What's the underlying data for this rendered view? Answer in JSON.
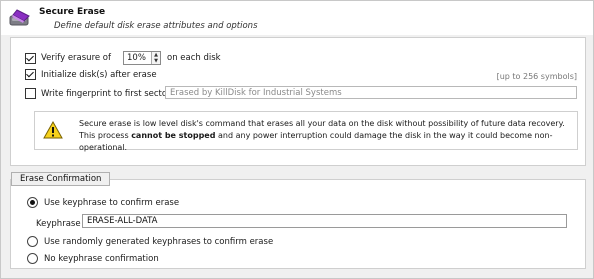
{
  "header": {
    "title": "Secure Erase",
    "subtitle": "Define default disk erase attributes and options",
    "icon": "disk-eraser-icon"
  },
  "options": {
    "verify_label": "Verify erasure of",
    "verify_checked": true,
    "verify_value": "10%",
    "verify_suffix": "on each disk",
    "initialize_label": "Initialize disk(s) after erase",
    "initialize_checked": true,
    "fingerprint_label": "Write fingerprint to first sector:",
    "fingerprint_checked": false,
    "fingerprint_placeholder": "Erased by KillDisk for Industrial Systems",
    "fingerprint_hint": "[up to 256 symbols]"
  },
  "warning": {
    "icon": "warning-icon",
    "line1": "Secure erase is low level disk's command that erases all your data on the disk without possibility of future data recovery.",
    "line2_pre": "This process ",
    "line2_bold": "cannot be stopped",
    "line2_post": " and any power interruption could damage the disk in the way it could become non-operational."
  },
  "confirmation": {
    "legend": "Erase Confirmation",
    "opt_keyphrase": "Use keyphrase to confirm erase",
    "keyphrase_label": "Keyphrase",
    "keyphrase_value": "ERASE-ALL-DATA",
    "opt_random": "Use randomly generated keyphrases to confirm erase",
    "opt_none": "No keyphrase confirmation",
    "selected": "keyphrase"
  }
}
